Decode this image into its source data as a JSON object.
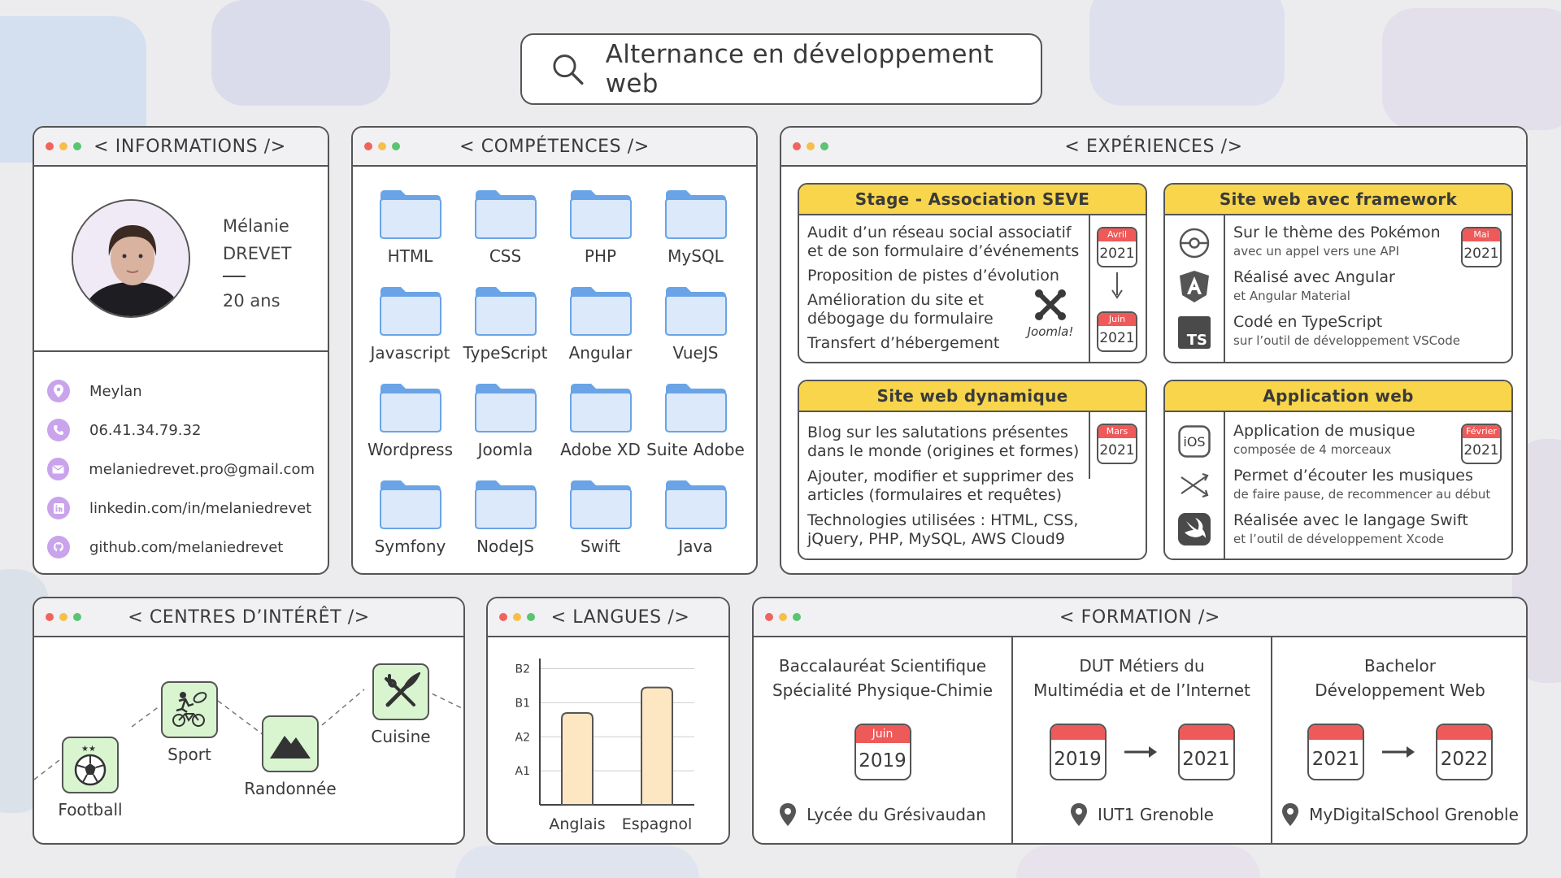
{
  "search": {
    "text": "Alternance en développement web"
  },
  "informations": {
    "title": "< INFORMATIONS />",
    "first_name": "Mélanie",
    "last_name": "DREVET",
    "age": "20 ans",
    "contacts": [
      {
        "icon": "location-icon",
        "text": "Meylan"
      },
      {
        "icon": "phone-icon",
        "text": "06.41.34.79.32"
      },
      {
        "icon": "mail-icon",
        "text": "melaniedrevet.pro@gmail.com"
      },
      {
        "icon": "linkedin-icon",
        "text": "linkedin.com/in/melaniedrevet"
      },
      {
        "icon": "github-icon",
        "text": "github.com/melaniedrevet"
      }
    ]
  },
  "competences": {
    "title": "< COMPÉTENCES />",
    "items": [
      "HTML",
      "CSS",
      "PHP",
      "MySQL",
      "Javascript",
      "TypeScript",
      "Angular",
      "VueJS",
      "Wordpress",
      "Joomla",
      "Adobe XD",
      "Suite Adobe",
      "Symfony",
      "NodeJS",
      "Swift",
      "Java"
    ]
  },
  "experiences": {
    "title": "< EXPÉRIENCES />",
    "stage": {
      "header": "Stage - Association SEVE",
      "lines": [
        "Audit d’un réseau social associatif",
        "et de son formulaire d’événements",
        "Proposition de pistes d’évolution",
        "Amélioration du site et",
        "débogage du formulaire",
        "Transfert d’hébergement"
      ],
      "logo": "Joomla!",
      "start": {
        "month": "Avril",
        "year": "2021"
      },
      "end": {
        "month": "Juin",
        "year": "2021"
      }
    },
    "framework": {
      "header": "Site web avec framework",
      "items": [
        {
          "icon": "pokeball-icon",
          "line": "Sur le thème des Pokémon",
          "sub": "avec un appel vers une API"
        },
        {
          "icon": "angular-icon",
          "line": "Réalisé avec Angular",
          "sub": "et Angular Material"
        },
        {
          "icon": "typescript-icon",
          "line": "Codé en TypeScript",
          "sub": "sur l’outil de développement VSCode"
        }
      ],
      "ts_label": "TS",
      "date": {
        "month": "Mai",
        "year": "2021"
      }
    },
    "dynamique": {
      "header": "Site web dynamique",
      "lines": [
        "Blog sur les salutations présentes",
        "dans le monde (origines et formes)",
        "Ajouter, modifier et supprimer des",
        "articles (formulaires et requêtes)",
        "Technologies utilisées : HTML, CSS,",
        "jQuery, PHP, MySQL, AWS Cloud9"
      ],
      "date": {
        "month": "Mars",
        "year": "2021"
      }
    },
    "application": {
      "header": "Application web",
      "items": [
        {
          "icon": "ios-icon",
          "line": "Application de musique",
          "sub": "composée de 4 morceaux"
        },
        {
          "icon": "music-controls-icon",
          "line": "Permet d’écouter les musiques",
          "sub": "de faire pause, de recommencer au début"
        },
        {
          "icon": "swift-icon",
          "line": "Réalisée avec le langage Swift",
          "sub": "et l’outil de développement Xcode"
        }
      ],
      "ios_label": "iOS",
      "date": {
        "month": "Février",
        "year": "2021"
      }
    }
  },
  "interets": {
    "title": "< CENTRES D’INTÉRÊT />",
    "items": [
      "Football",
      "Sport",
      "Randonnée",
      "Cuisine"
    ]
  },
  "langues": {
    "title": "< LANGUES />",
    "chart_data": {
      "type": "bar",
      "categories": [
        "Anglais",
        "Espagnol"
      ],
      "levels": [
        "A1",
        "A2",
        "B1",
        "B2"
      ],
      "values": [
        2.7,
        3.45
      ],
      "ylim": [
        0,
        4.3
      ],
      "color": "#fde7c3"
    }
  },
  "formation": {
    "title": "< FORMATION />",
    "items": [
      {
        "line1": "Baccalauréat Scientifique",
        "line2": "Spécialité Physique-Chimie",
        "month": "Juin",
        "year": "2019",
        "location": "Lycée du Grésivaudan"
      },
      {
        "line1": "DUT Métiers du",
        "line2": "Multimédia et de l’Internet",
        "from": "2019",
        "to": "2021",
        "location": "IUT1 Grenoble"
      },
      {
        "line1": "Bachelor",
        "line2": "Développement Web",
        "from": "2021",
        "to": "2022",
        "location": "MyDigitalSchool Grenoble"
      }
    ]
  }
}
